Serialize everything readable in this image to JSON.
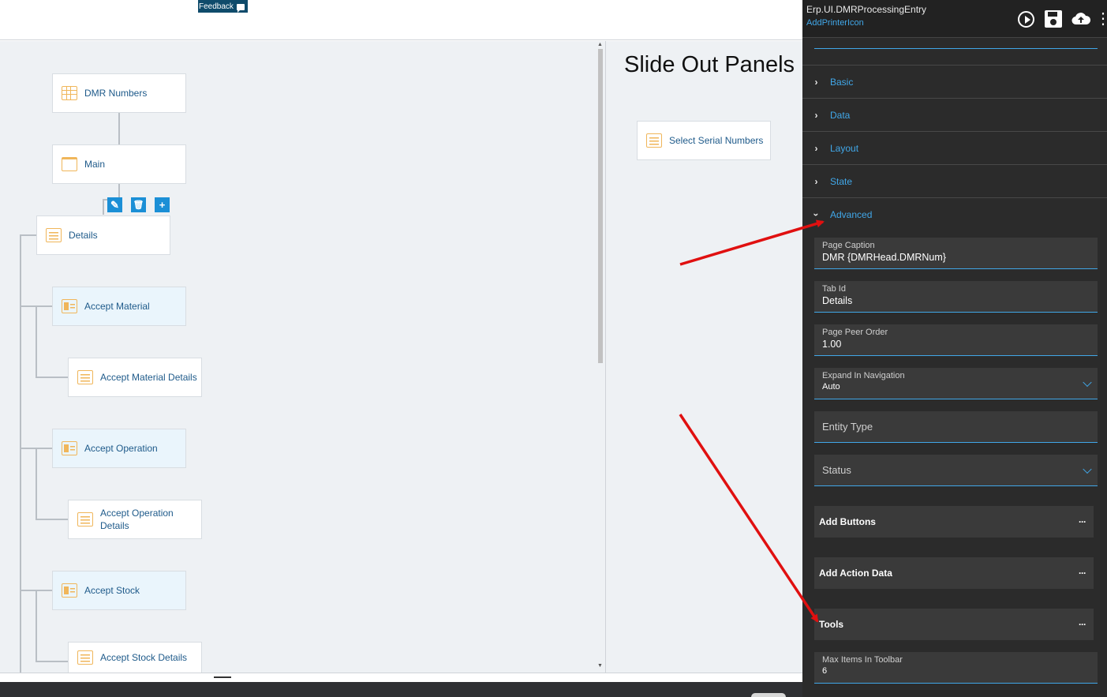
{
  "header": {
    "feedback_label": "Feedback"
  },
  "tree": {
    "nodes": [
      {
        "label": "DMR Numbers",
        "icon": "grid-icon"
      },
      {
        "label": "Main",
        "icon": "folder-icon"
      },
      {
        "label": "Details",
        "icon": "list-icon"
      },
      {
        "label": "Accept Material",
        "icon": "split-panel-icon"
      },
      {
        "label": "Accept Material Details",
        "icon": "list-icon"
      },
      {
        "label": "Accept Operation",
        "icon": "split-panel-icon"
      },
      {
        "label": "Accept Operation Details",
        "icon": "list-icon"
      },
      {
        "label": "Accept Stock",
        "icon": "split-panel-icon"
      },
      {
        "label": "Accept Stock Details",
        "icon": "list-icon"
      }
    ],
    "node_tools": [
      "edit-icon",
      "delete-icon",
      "add-icon"
    ]
  },
  "slide_out": {
    "title": "Slide Out Panels",
    "panels": [
      {
        "label": "Select Serial Numbers",
        "icon": "list-icon"
      }
    ]
  },
  "properties": {
    "title": "Erp.UI.DMRProcessingEntry",
    "subtitle": "AddPrinterIcon",
    "header_icons": [
      "play-icon",
      "save-icon",
      "cloud-upload-icon",
      "more-vertical-icon"
    ],
    "sections": [
      {
        "label": "Basic",
        "expanded": false
      },
      {
        "label": "Data",
        "expanded": false
      },
      {
        "label": "Layout",
        "expanded": false
      },
      {
        "label": "State",
        "expanded": false
      },
      {
        "label": "Advanced",
        "expanded": true
      }
    ],
    "fields": {
      "page_caption": {
        "label": "Page Caption",
        "value": "DMR {DMRHead.DMRNum}"
      },
      "tab_id": {
        "label": "Tab Id",
        "value": "Details"
      },
      "page_peer_order": {
        "label": "Page Peer Order",
        "value": "1.00"
      },
      "expand_in_navigation": {
        "label": "Expand In Navigation",
        "value": "Auto"
      },
      "entity_type": {
        "label": "Entity Type",
        "value": ""
      },
      "status": {
        "label": "Status",
        "value": ""
      },
      "max_items_in_toolbar": {
        "label": "Max Items In Toolbar",
        "value": "6"
      }
    },
    "collections": [
      {
        "label": "Add Buttons",
        "action": "···"
      },
      {
        "label": "Add Action Data",
        "action": "···"
      },
      {
        "label": "Tools",
        "action": "···"
      }
    ]
  },
  "colors": {
    "accent": "#41a7e8",
    "panel_bg": "#2b2b2b",
    "canvas_bg": "#eef1f4",
    "icon_orange": "#f0b65a",
    "annotation_red": "#e01010"
  }
}
